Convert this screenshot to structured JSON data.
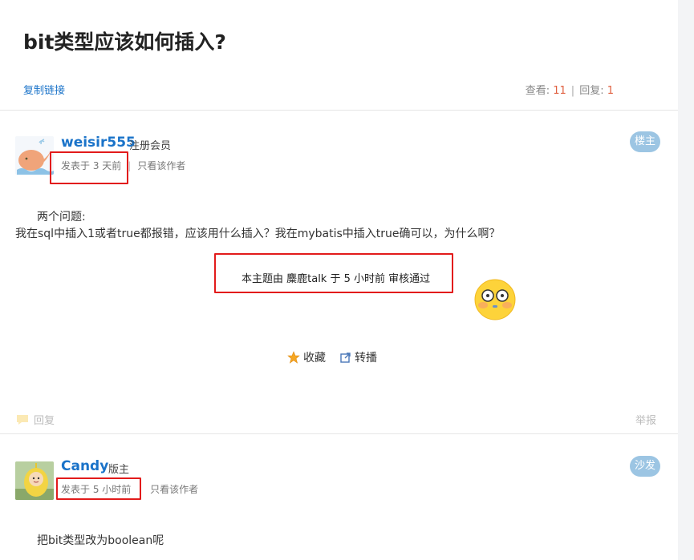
{
  "thread": {
    "title": "bit类型应该如何插入?",
    "copy_link_label": "复制链接",
    "stats": {
      "views_label": "查看:",
      "views": "11",
      "replies_label": "回复:",
      "replies": "1"
    }
  },
  "posts": [
    {
      "username": "weisir555",
      "role": "注册会员",
      "posted_time": "发表于 3 天前",
      "only_author_label": "只看该作者",
      "floor_badge": "楼主",
      "content_lines": [
        "两个问题:",
        "我在sql中插入1或者true都报错，应该用什么插入？我在mybatis中插入true确可以，为什么啊？"
      ],
      "audit_notice": "本主题由 麋鹿talk 于 5 小时前 审核通过",
      "actions": {
        "favorite_label": "收藏",
        "share_label": "转播"
      },
      "reply_label": "回复",
      "report_label": "举报"
    },
    {
      "username": "Candy",
      "role": "版主",
      "posted_time": "发表于 5 小时前",
      "only_author_label": "只看该作者",
      "floor_badge": "沙发",
      "content_lines": [
        "把bit类型改为boolean呢"
      ]
    }
  ],
  "colors": {
    "link": "#1a73c9",
    "badge": "#9cc5e3",
    "highlight_box": "#e21b1b",
    "count": "#e06040"
  },
  "icons": [
    "whale-avatar",
    "teletubby-avatar",
    "flushed-emoji-icon",
    "star-icon",
    "share-icon",
    "reply-bubble-icon"
  ]
}
